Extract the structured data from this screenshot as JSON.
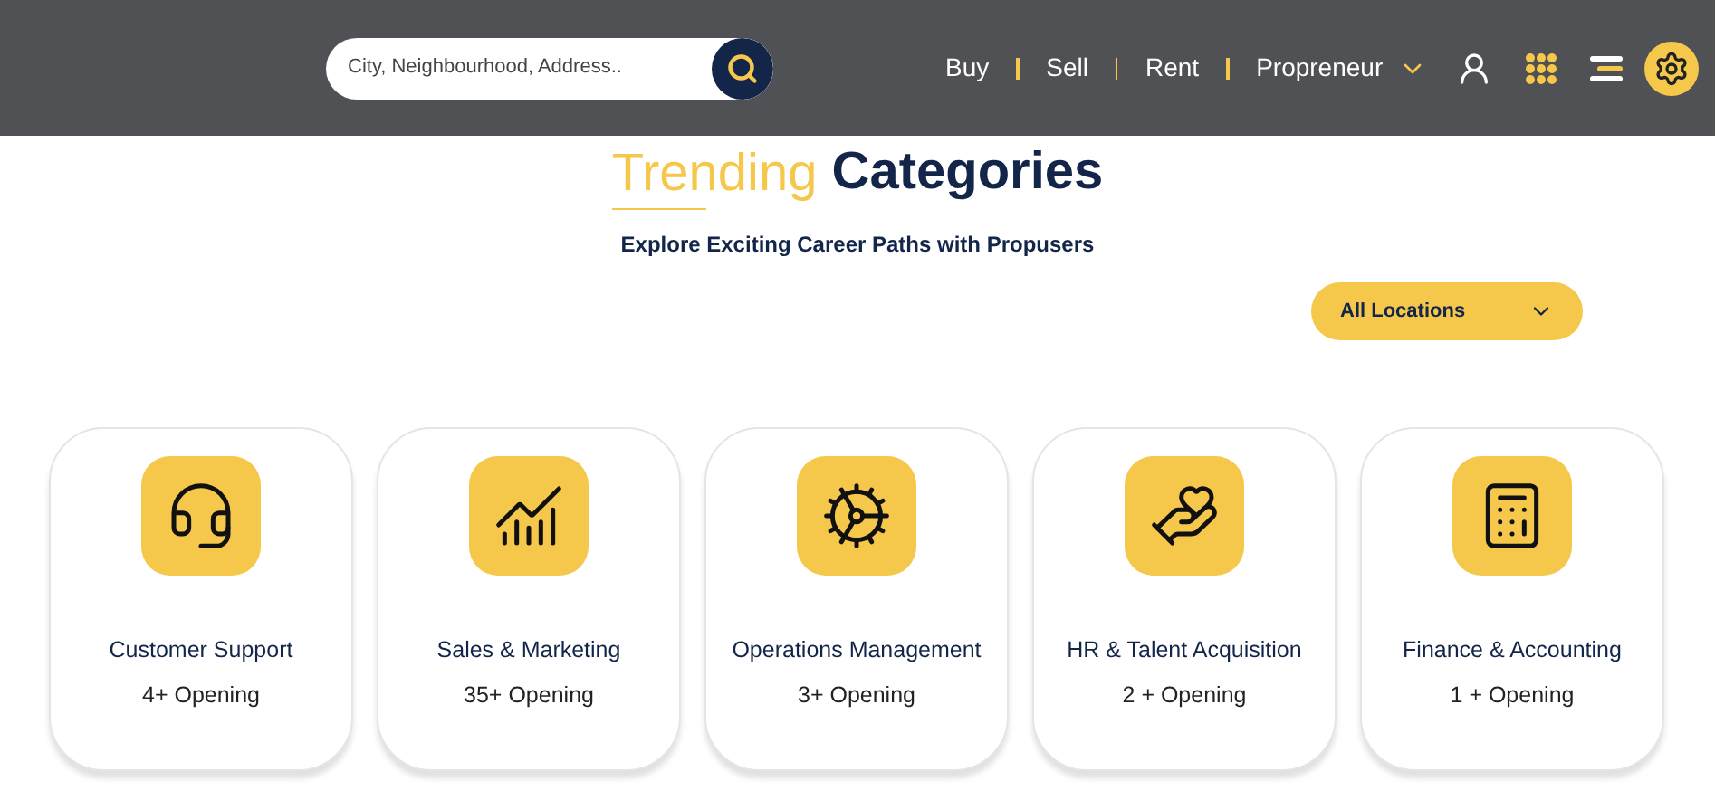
{
  "header": {
    "search": {
      "placeholder": "City, Neighbourhood, Address.."
    },
    "nav": [
      {
        "label": "Buy",
        "has_menu": false
      },
      {
        "label": "Sell",
        "has_menu": false
      },
      {
        "label": "Rent",
        "has_menu": false
      },
      {
        "label": "Propreneur",
        "has_menu": true
      }
    ]
  },
  "section": {
    "title_light": "Trending",
    "title_bold": "Categories",
    "subtitle": "Explore Exciting Career Paths with Propusers",
    "location_filter": "All Locations"
  },
  "categories": [
    {
      "kind": "support",
      "name": "Customer Support",
      "openings": "4+ Opening"
    },
    {
      "kind": "sales",
      "name": "Sales & Marketing",
      "openings": "35+ Opening"
    },
    {
      "kind": "operations",
      "name": "Operations Management",
      "openings": "3+ Opening"
    },
    {
      "kind": "hr",
      "name": "HR & Talent Acquisition",
      "openings": "2 + Opening"
    },
    {
      "kind": "finance",
      "name": "Finance & Accounting",
      "openings": "1 + Opening"
    }
  ]
}
